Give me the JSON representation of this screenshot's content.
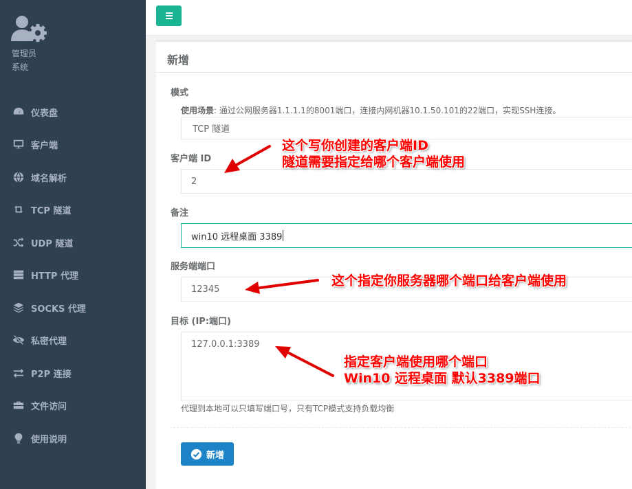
{
  "sidebar": {
    "role_line1": "管理员",
    "role_line2": "系统",
    "items": [
      {
        "label": "仪表盘",
        "icon": "dashboard-icon"
      },
      {
        "label": "客户端",
        "icon": "desktop-icon"
      },
      {
        "label": "域名解析",
        "icon": "globe-icon"
      },
      {
        "label": "TCP 隧道",
        "icon": "retweet-icon"
      },
      {
        "label": "UDP 隧道",
        "icon": "random-icon"
      },
      {
        "label": "HTTP 代理",
        "icon": "server-icon"
      },
      {
        "label": "SOCKS 代理",
        "icon": "layers-icon"
      },
      {
        "label": "私密代理",
        "icon": "eye-slash-icon"
      },
      {
        "label": "P2P 连接",
        "icon": "exchange-icon"
      },
      {
        "label": "文件访问",
        "icon": "briefcase-icon"
      },
      {
        "label": "使用说明",
        "icon": "lightbulb-icon"
      }
    ]
  },
  "form": {
    "title": "新增",
    "mode_label": "模式",
    "usage_bold": "使用场景",
    "usage_text": ": 通过公网服务器1.1.1.1的8001端口，连接内网机器10.1.50.101的22端口，实现SSH连接。",
    "mode_value": "TCP 隧道",
    "client_id_label": "客户端 ID",
    "client_id_value": "2",
    "remark_label": "备注",
    "remark_value": "win10 远程桌面 3389",
    "server_port_label": "服务端端口",
    "server_port_value": "12345",
    "target_label": "目标 (IP:端口)",
    "target_value": "127.0.0.1:3389",
    "target_help": "代理到本地可以只填写端口号，只有TCP模式支持负载均衡",
    "submit_label": "新增"
  },
  "annotations": {
    "client_line1": "这个写你创建的客户端ID",
    "client_line2": "隧道需要指定给哪个客户端使用",
    "server_port": "这个指定你服务器哪个端口给客户端使用",
    "target_line1": "指定客户端使用哪个端口",
    "target_line2": "Win10 远程桌面 默认3389端口"
  },
  "colors": {
    "sidebar_bg": "#2f4050",
    "accent_green": "#1ab394",
    "primary_blue": "#1c84c6",
    "annotation_red": "#ff0000"
  }
}
